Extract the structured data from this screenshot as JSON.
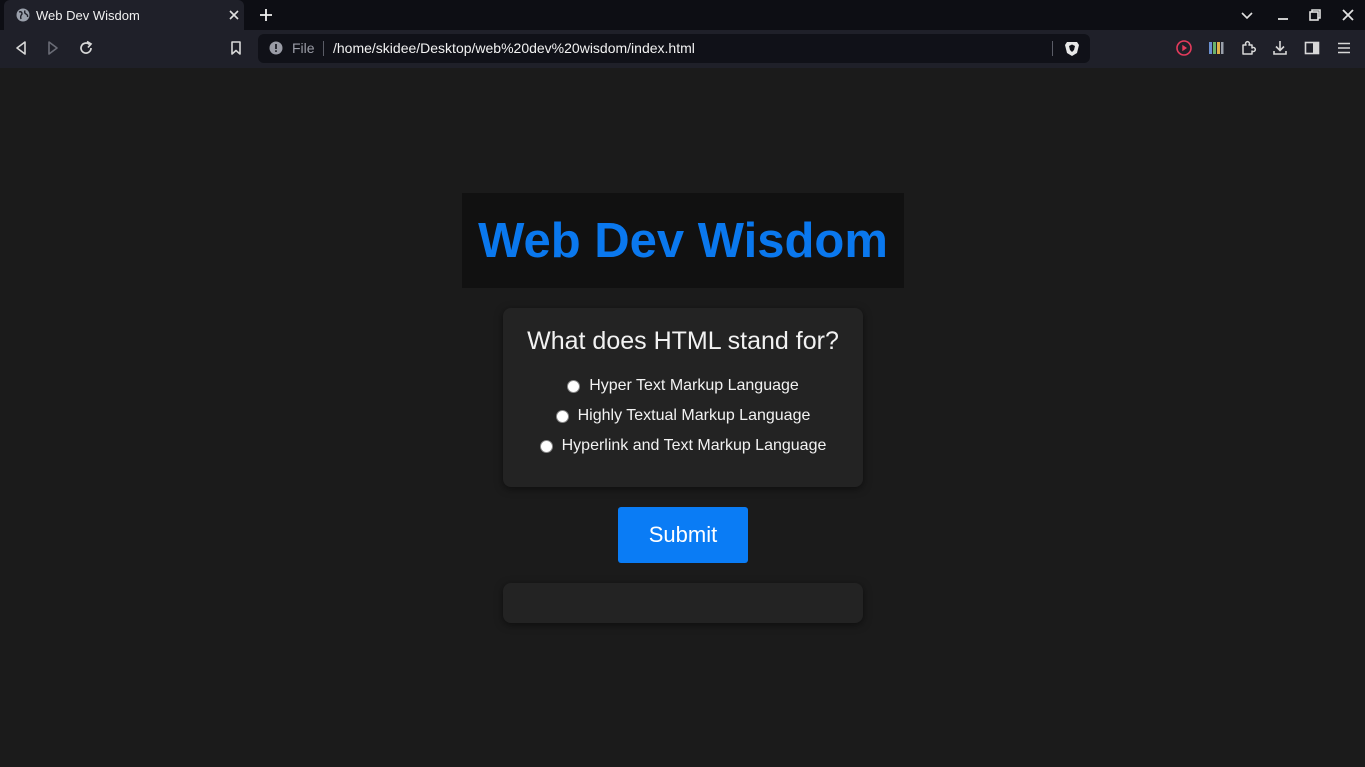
{
  "browser": {
    "tab_title": "Web Dev Wisdom",
    "url_scheme": "File",
    "url_path": "/home/skidee/Desktop/web%20dev%20wisdom/index.html"
  },
  "page": {
    "heading": "Web Dev Wisdom",
    "question": "What does HTML stand for?",
    "options": [
      {
        "label": "Hyper Text Markup Language"
      },
      {
        "label": "Highly Textual Markup Language"
      },
      {
        "label": "Hyperlink and Text Markup Language"
      }
    ],
    "submit_label": "Submit",
    "result_text": ""
  },
  "colors": {
    "accent": "#0a78ee",
    "button": "#0a7cf5",
    "page_bg": "#1b1b1b"
  }
}
